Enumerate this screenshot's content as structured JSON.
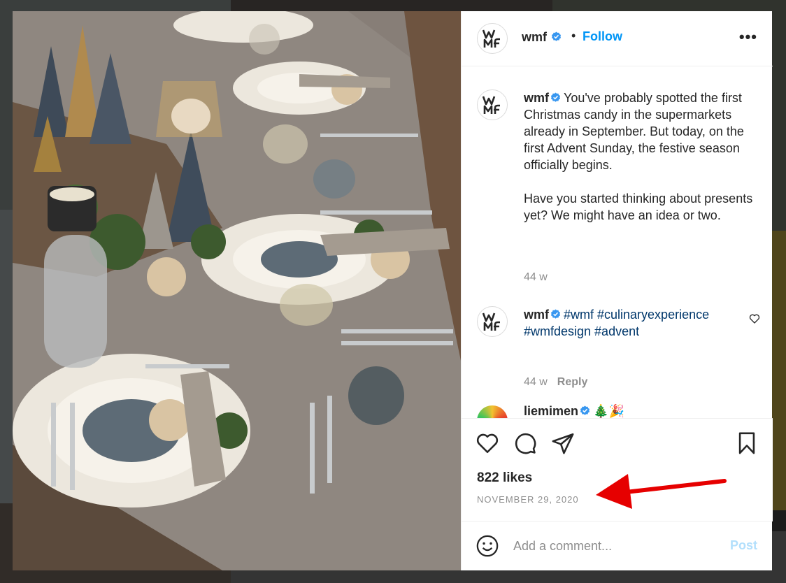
{
  "post": {
    "username": "wmf",
    "verified": true,
    "follow_label": "Follow",
    "more_label": "•••",
    "separator": "•"
  },
  "comments": [
    {
      "username": "wmf",
      "text": "You've probably spotted the first Christmas candy in the supermarkets already in September. But today, on the first Advent Sunday, the festive season officially begins.\n\nHave you started thinking about presents yet? We might have an idea or two.",
      "time": "44 w"
    },
    {
      "username": "wmf",
      "hashtags": "#wmf #culinaryexperience #wmfdesign #advent",
      "time": "44 w",
      "reply_label": "Reply"
    },
    {
      "username": "liemimen",
      "emoji": "🎄🎉"
    }
  ],
  "likes": "822 likes",
  "date": "NOVEMBER 29, 2020",
  "add_comment": {
    "placeholder": "Add a comment...",
    "post_label": "Post"
  },
  "icons": {
    "like": "heart-icon",
    "comment": "comment-bubble-icon",
    "share": "paper-plane-icon",
    "save": "bookmark-icon",
    "emoji": "smiley-icon",
    "comment_like": "heart-small-icon"
  },
  "colors": {
    "accent": "#0095f6",
    "verified": "#3897f0",
    "post_disabled": "#b2dffc",
    "annotation_arrow": "#e60000"
  }
}
